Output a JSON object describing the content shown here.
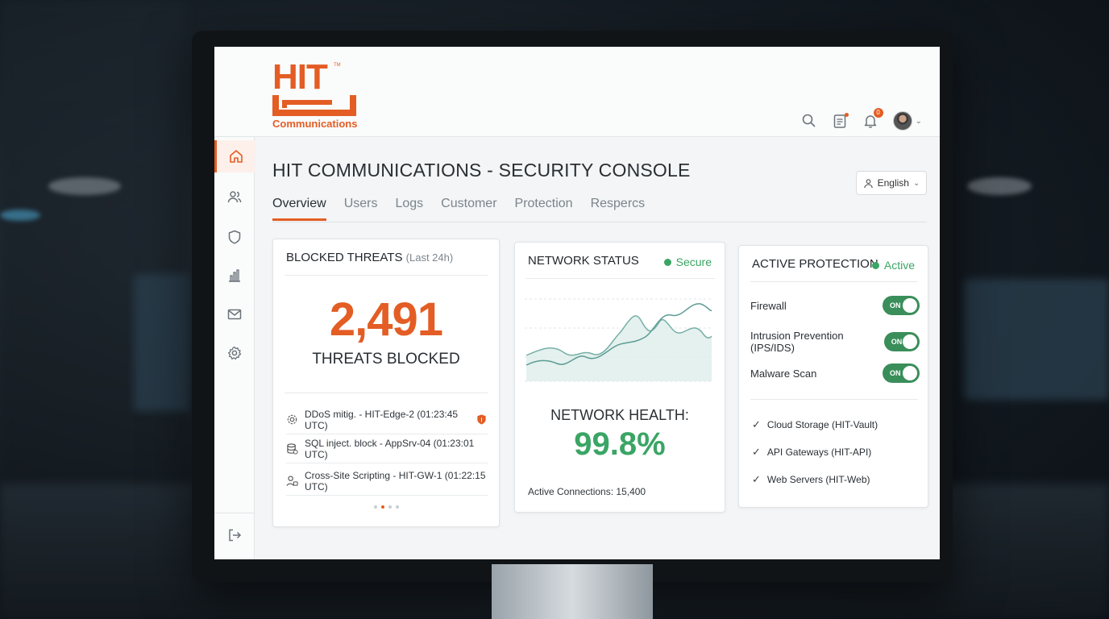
{
  "brand": {
    "logo_text": "HIT",
    "logo_trademark": "TM",
    "logo_subtext": "Communications",
    "accent_color": "#e35d24",
    "success_color": "#3aa565"
  },
  "header": {
    "icons": [
      "search-icon",
      "document-icon",
      "bell-icon",
      "avatar",
      "chevron-down-icon"
    ],
    "notification_count": "0"
  },
  "sidebar": {
    "items": [
      {
        "icon": "home-icon",
        "active": true
      },
      {
        "icon": "users-icon",
        "active": false
      },
      {
        "icon": "shield-icon",
        "active": false
      },
      {
        "icon": "bar-chart-icon",
        "active": false
      },
      {
        "icon": "mail-icon",
        "active": false
      },
      {
        "icon": "gear-icon",
        "active": false
      }
    ],
    "bottom_icon": "logout-icon"
  },
  "page": {
    "title": "HIT COMMUNICATIONS - SECURITY CONSOLE",
    "language": "English",
    "tabs": [
      {
        "label": "Overview",
        "active": true
      },
      {
        "label": "Users",
        "active": false
      },
      {
        "label": "Logs",
        "active": false
      },
      {
        "label": "Customer",
        "active": false
      },
      {
        "label": "Protection",
        "active": false
      },
      {
        "label": "Respercs",
        "active": false
      }
    ]
  },
  "blocked_threats": {
    "title": "BLOCKED THREATS",
    "subtitle": "(Last 24h)",
    "count": "2,491",
    "count_label": "THREATS BLOCKED",
    "events": [
      {
        "icon": "gear-shield-icon",
        "text": "DDoS mitig. - HIT-Edge-2 (01:23:45 UTC)",
        "flag": "shield-alert-icon"
      },
      {
        "icon": "database-icon",
        "text": "SQL inject. block - AppSrv-04 (01:23:01 UTC)"
      },
      {
        "icon": "user-lock-icon",
        "text": "Cross-Site Scripting - HIT-GW-1 (01:22:15 UTC)"
      }
    ],
    "pager": {
      "pages": 4,
      "current": 2
    }
  },
  "network_status": {
    "title": "NETWORK STATUS",
    "status": "Secure",
    "health_label": "NETWORK HEALTH:",
    "health_value": "99.8%",
    "connections": "Active Connections: 15,400"
  },
  "active_protection": {
    "title": "ACTIVE PROTECTION",
    "status": "Active",
    "toggles": [
      {
        "label": "Firewall",
        "state": "ON"
      },
      {
        "label": "Intrusion Prevention (IPS/IDS)",
        "state": "ON"
      },
      {
        "label": "Malware Scan",
        "state": "ON"
      }
    ],
    "checks": [
      {
        "label": "Cloud Storage (HIT-Vault)"
      },
      {
        "label": "API Gateways (HIT-API)"
      },
      {
        "label": "Web Servers (HIT-Web)"
      }
    ]
  }
}
